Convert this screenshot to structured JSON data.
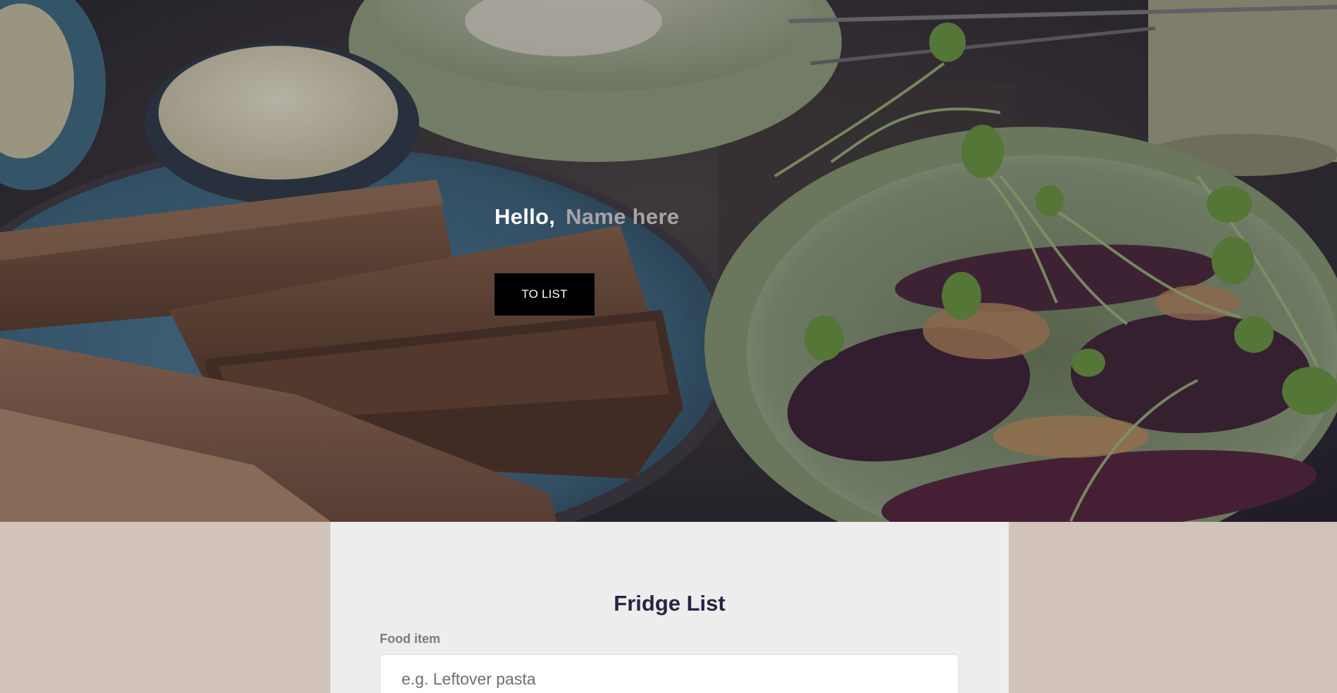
{
  "hero": {
    "greeting_prefix": "Hello,",
    "user_name": "Name here",
    "button_label": "TO LIST"
  },
  "fridge_card": {
    "title": "Fridge List",
    "food_item_label": "Food item",
    "food_item_placeholder": "e.g. Leftover pasta",
    "food_item_value": ""
  },
  "colors": {
    "page_background": "#d1c3bb",
    "card_background": "#ededed",
    "title_color": "#262543",
    "button_background": "#000000",
    "name_placeholder_color": "#a9a3a7"
  }
}
